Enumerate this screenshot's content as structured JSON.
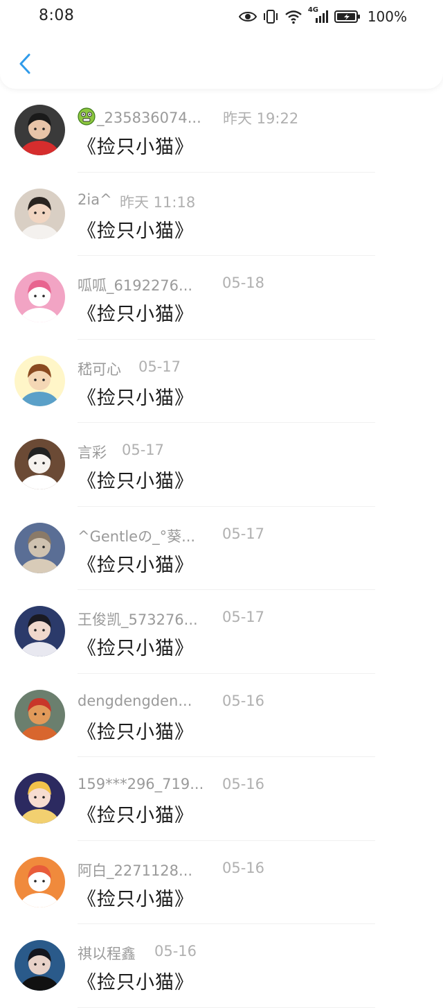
{
  "status_bar": {
    "time": "8:08",
    "network": "4G",
    "battery": "100%"
  },
  "header": {
    "back_icon": "chevron-left-icon",
    "accent_color": "#2f9bea"
  },
  "messages": [
    {
      "name": "_235836074...",
      "time": "昨天 19:22",
      "text": "《捡只小猫》",
      "name_emoji": "green-face-emoji"
    },
    {
      "name": "2ia^",
      "time": "昨天 11:18",
      "text": "《捡只小猫》"
    },
    {
      "name": "呱呱_6192276...",
      "time": "05-18",
      "text": "《捡只小猫》"
    },
    {
      "name": "嵇可心",
      "time": "05-17",
      "text": "《捡只小猫》"
    },
    {
      "name": "言彩",
      "time": "05-17",
      "text": "《捡只小猫》"
    },
    {
      "name": "^Gentleの_°葵...",
      "time": "05-17",
      "text": "《捡只小猫》"
    },
    {
      "name": "王俊凯_573276...",
      "time": "05-17",
      "text": "《捡只小猫》"
    },
    {
      "name": "dengdengden...",
      "time": "05-16",
      "text": "《捡只小猫》"
    },
    {
      "name": "159***296_719...",
      "time": "05-16",
      "text": "《捡只小猫》"
    },
    {
      "name": "阿白_2271128...",
      "time": "05-16",
      "text": "《捡只小猫》"
    },
    {
      "name": "祺以程鑫",
      "time": "05-16",
      "text": "《捡只小猫》"
    }
  ]
}
